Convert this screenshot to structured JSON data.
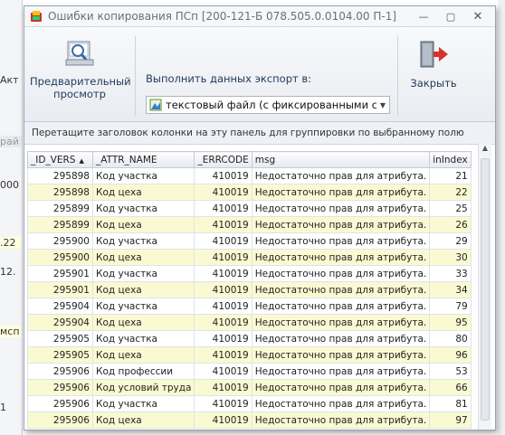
{
  "background_app": {
    "fragments": [
      "Акт",
      "рай",
      "000",
      ".22",
      "12.",
      "мсп",
      "1"
    ]
  },
  "window": {
    "title": "Ошибки копирования ПСп [200-121-Б 078.505.0.0104.00 П-1]",
    "minimize_glyph": "—",
    "maximize_glyph": "▢",
    "close_glyph": "✕"
  },
  "ribbon": {
    "preview_label_line1": "Предварительный",
    "preview_label_line2": "просмотр",
    "export_label": "Выполнить данных экспорт в:",
    "export_value": "текстовый файл (с фиксированными столб",
    "close_label": "Закрыть"
  },
  "grid": {
    "group_hint": "Перетащите заголовок колонки на эту панель для группировки по выбранному полю",
    "columns": [
      "_ID_VERS",
      "_ATTR_NAME",
      "_ERRCODE",
      "msg",
      "inIndex"
    ],
    "rows": [
      [
        "295898",
        "Код участка",
        "410019",
        "Недостаточно прав для атрибута.",
        "21"
      ],
      [
        "295898",
        "Код цеха",
        "410019",
        "Недостаточно прав для атрибута.",
        "22"
      ],
      [
        "295899",
        "Код участка",
        "410019",
        "Недостаточно прав для атрибута.",
        "25"
      ],
      [
        "295899",
        "Код цеха",
        "410019",
        "Недостаточно прав для атрибута.",
        "26"
      ],
      [
        "295900",
        "Код участка",
        "410019",
        "Недостаточно прав для атрибута.",
        "29"
      ],
      [
        "295900",
        "Код цеха",
        "410019",
        "Недостаточно прав для атрибута.",
        "30"
      ],
      [
        "295901",
        "Код участка",
        "410019",
        "Недостаточно прав для атрибута.",
        "33"
      ],
      [
        "295901",
        "Код цеха",
        "410019",
        "Недостаточно прав для атрибута.",
        "34"
      ],
      [
        "295904",
        "Код участка",
        "410019",
        "Недостаточно прав для атрибута.",
        "79"
      ],
      [
        "295904",
        "Код цеха",
        "410019",
        "Недостаточно прав для атрибута.",
        "95"
      ],
      [
        "295905",
        "Код участка",
        "410019",
        "Недостаточно прав для атрибута.",
        "80"
      ],
      [
        "295905",
        "Код цеха",
        "410019",
        "Недостаточно прав для атрибута.",
        "96"
      ],
      [
        "295906",
        "Код профессии",
        "410019",
        "Недостаточно прав для атрибута.",
        "53"
      ],
      [
        "295906",
        "Код условий труда",
        "410019",
        "Недостаточно прав для атрибута.",
        "66"
      ],
      [
        "295906",
        "Код участка",
        "410019",
        "Недостаточно прав для атрибута.",
        "81"
      ],
      [
        "295906",
        "Код цеха",
        "410019",
        "Недостаточно прав для атрибута.",
        "97"
      ]
    ]
  }
}
